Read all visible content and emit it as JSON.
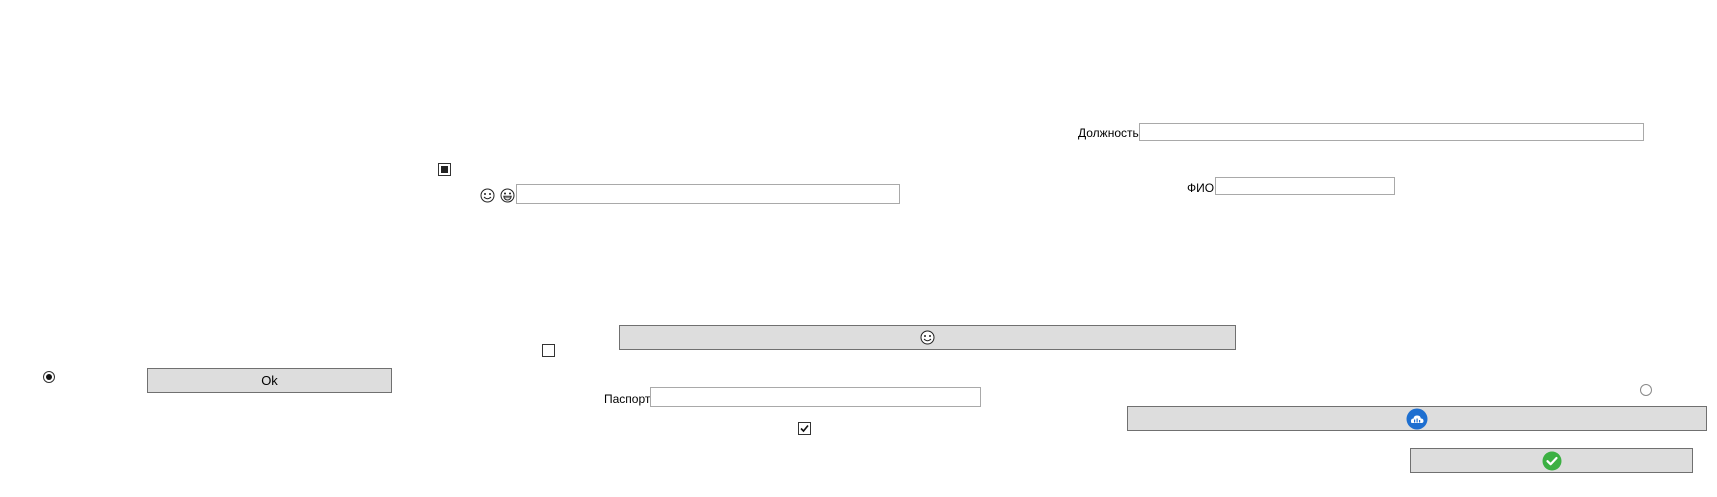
{
  "fields": {
    "position_label": "Должность",
    "position_value": "",
    "fio_label": "ФИО",
    "fio_value": "",
    "passport_label": "Паспорт",
    "passport_value": "",
    "emoji_field_value": ""
  },
  "buttons": {
    "ok_label": "Ok"
  },
  "checkboxes": {
    "top_left_state": "indeterminate",
    "middle_state": "unchecked",
    "bottom_state": "checked"
  },
  "radios": {
    "left_state": "checked",
    "right_state": "unchecked"
  },
  "icons": {
    "smiley_button_icon": "smiley-face-icon",
    "cloud_button_icon": "cloud-icon",
    "confirm_button_icon": "check-circle-icon",
    "emoji_pair": [
      "smiley-face-icon",
      "grinning-face-icon"
    ]
  },
  "colors": {
    "button_bg": "#dddddd",
    "cloud_blue": "#1e6fd0",
    "check_green": "#3cb043"
  }
}
